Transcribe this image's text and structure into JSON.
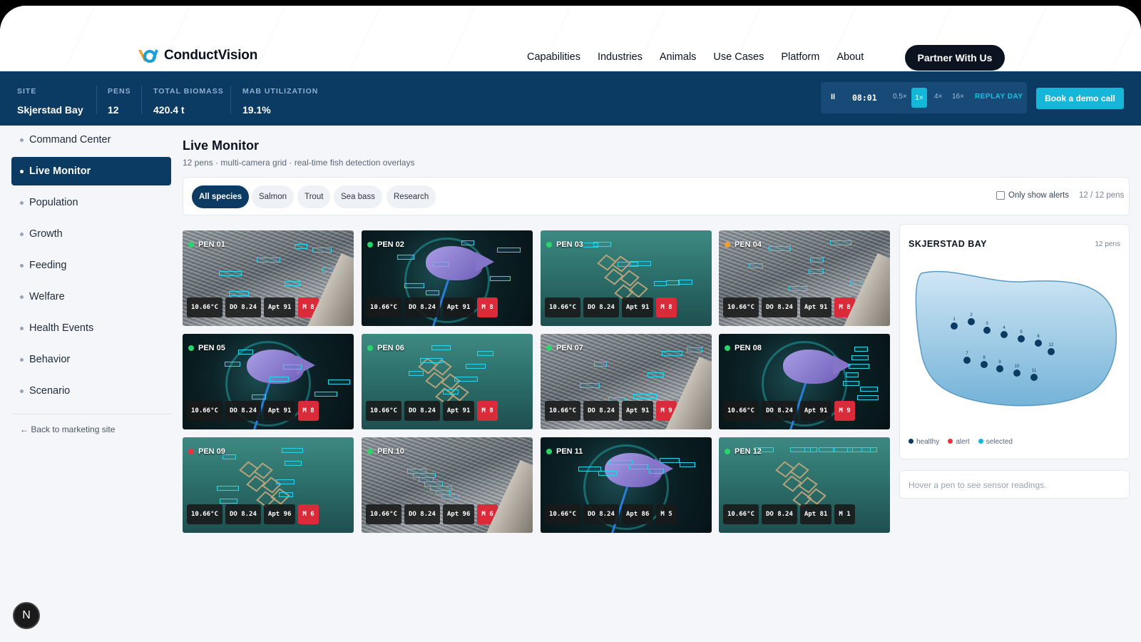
{
  "brand": {
    "name": "ConductVision"
  },
  "nav": {
    "items": [
      "Capabilities",
      "Industries",
      "Animals",
      "Use Cases",
      "Platform",
      "About"
    ],
    "cta": "Partner With Us"
  },
  "stats": [
    {
      "label": "SITE",
      "value": "Skjerstad Bay"
    },
    {
      "label": "PENS",
      "value": "12"
    },
    {
      "label": "TOTAL BIOMASS",
      "value": "420.4 t"
    },
    {
      "label": "MAB UTILIZATION",
      "value": "19.1%"
    }
  ],
  "player": {
    "pause": "II",
    "time": "08:01",
    "speeds": [
      "0.5×",
      "1×",
      "4×",
      "16×"
    ],
    "active_speed": "1×",
    "replay": "REPLAY DAY"
  },
  "demo_button": "Book a demo call",
  "sidebar": {
    "items": [
      "Command Center",
      "Live Monitor",
      "Population",
      "Growth",
      "Feeding",
      "Welfare",
      "Health Events",
      "Behavior",
      "Scenario"
    ],
    "active": "Live Monitor",
    "back": "← Back to marketing site"
  },
  "fab": "N",
  "page": {
    "title": "Live Monitor",
    "subtitle": "12 pens · multi-camera grid · real-time fish detection overlays"
  },
  "filters": {
    "chips": [
      "All species",
      "Salmon",
      "Trout",
      "Sea bass",
      "Research"
    ],
    "active": "All species",
    "only_alerts": "Only show alerts",
    "count": "12 / 12 pens"
  },
  "pens": [
    {
      "name": "PEN 01",
      "status": "#2bd46c",
      "temp": "10.66°C",
      "do": "DO 8.24",
      "apt": "Apt 91",
      "m": "M 8",
      "alert": true
    },
    {
      "name": "PEN 02",
      "status": "#2bd46c",
      "temp": "10.66°C",
      "do": "DO 8.24",
      "apt": "Apt 91",
      "m": "M 8",
      "alert": true
    },
    {
      "name": "PEN 03",
      "status": "#2bd46c",
      "temp": "10.66°C",
      "do": "DO 8.24",
      "apt": "Apt 91",
      "m": "M 8",
      "alert": true
    },
    {
      "name": "PEN 04",
      "status": "#f0a030",
      "temp": "10.66°C",
      "do": "DO 8.24",
      "apt": "Apt 91",
      "m": "M 8",
      "alert": true
    },
    {
      "name": "PEN 05",
      "status": "#2bd46c",
      "temp": "10.66°C",
      "do": "DO 8.24",
      "apt": "Apt 91",
      "m": "M 8",
      "alert": true
    },
    {
      "name": "PEN 06",
      "status": "#2bd46c",
      "temp": "10.66°C",
      "do": "DO 8.24",
      "apt": "Apt 91",
      "m": "M 8",
      "alert": true
    },
    {
      "name": "PEN 07",
      "status": "#2bd46c",
      "temp": "10.66°C",
      "do": "DO 8.24",
      "apt": "Apt 91",
      "m": "M 9",
      "alert": true
    },
    {
      "name": "PEN 08",
      "status": "#2bd46c",
      "temp": "10.66°C",
      "do": "DO 8.24",
      "apt": "Apt 91",
      "m": "M 9",
      "alert": true
    },
    {
      "name": "PEN 09",
      "status": "#e8343c",
      "temp": "10.66°C",
      "do": "DO 8.24",
      "apt": "Apt 96",
      "m": "M 6",
      "alert": true
    },
    {
      "name": "PEN 10",
      "status": "#2bd46c",
      "temp": "10.66°C",
      "do": "DO 8.24",
      "apt": "Apt 96",
      "m": "M 6",
      "alert": true
    },
    {
      "name": "PEN 11",
      "status": "#2bd46c",
      "temp": "10.66°C",
      "do": "DO 8.24",
      "apt": "Apt 86",
      "m": "M 5",
      "alert": false
    },
    {
      "name": "PEN 12",
      "status": "#2bd46c",
      "temp": "10.66°C",
      "do": "DO 8.24",
      "apt": "Apt 81",
      "m": "M 1",
      "alert": false
    }
  ],
  "map": {
    "title": "SKJERSTAD BAY",
    "count": "12 pens",
    "pen_labels": [
      "1",
      "2",
      "3",
      "4",
      "5",
      "6",
      "7",
      "8",
      "9",
      "10",
      "11",
      "12"
    ],
    "legend": [
      {
        "label": "healthy",
        "color": "#0b3a63"
      },
      {
        "label": "alert",
        "color": "#e8343c"
      },
      {
        "label": "selected",
        "color": "#16b6d9"
      }
    ]
  },
  "hover_hint": "Hover a pen to see sensor readings."
}
